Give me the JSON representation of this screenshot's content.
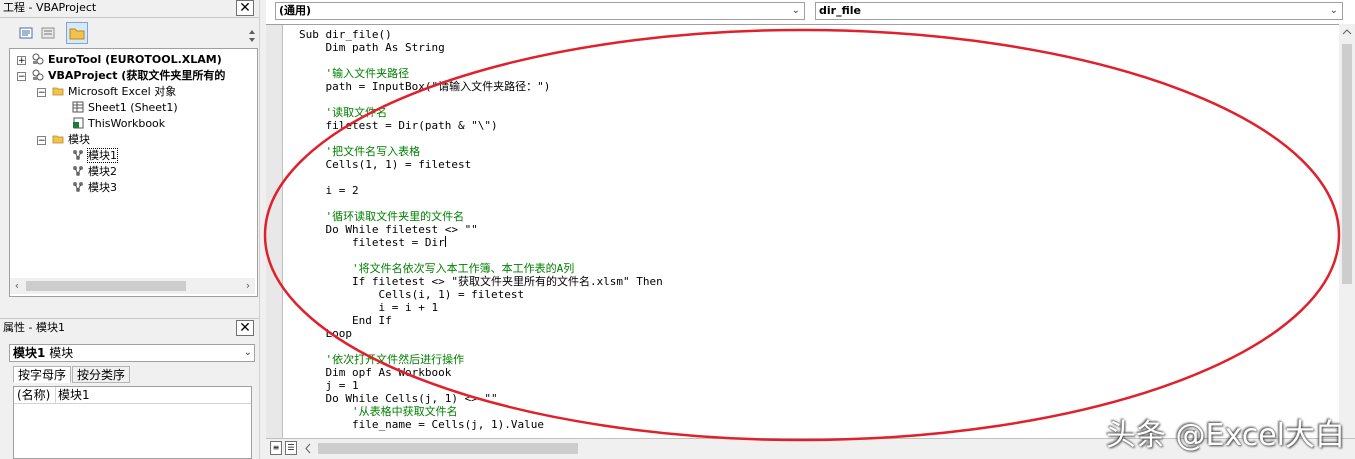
{
  "project_explorer": {
    "title": "工程 - VBAProject",
    "close_glyph": "✕",
    "toolbar_icons": [
      "view-code-icon",
      "view-object-icon",
      "toggle-folders-icon"
    ],
    "tree": [
      {
        "label": "EuroTool (EUROTOOL.XLAM)",
        "expander": "+",
        "icon": "vba-project-icon",
        "bold": true
      },
      {
        "label": "VBAProject (获取文件夹里所有的",
        "expander": "−",
        "icon": "vba-project-icon",
        "bold": true
      },
      {
        "label": "Microsoft Excel 对象",
        "expander": "−",
        "icon": "folder-icon",
        "bold": false
      },
      {
        "label": "Sheet1 (Sheet1)",
        "expander": "",
        "icon": "worksheet-icon",
        "bold": false
      },
      {
        "label": "ThisWorkbook",
        "expander": "",
        "icon": "workbook-icon",
        "bold": false
      },
      {
        "label": "模块",
        "expander": "−",
        "icon": "folder-icon",
        "bold": false
      },
      {
        "label": "模块1",
        "expander": "",
        "icon": "module-icon",
        "bold": false
      },
      {
        "label": "模块2",
        "expander": "",
        "icon": "module-icon",
        "bold": false
      },
      {
        "label": "模块3",
        "expander": "",
        "icon": "module-icon",
        "bold": false
      }
    ]
  },
  "properties": {
    "title": "属性 - 模块1",
    "close_glyph": "✕",
    "object_name": "模块1",
    "object_type": "模块",
    "tabs": [
      "按字母序",
      "按分类序"
    ],
    "active_tab": 0,
    "rows": [
      {
        "name": "(名称)",
        "value": "模块1"
      }
    ]
  },
  "code_window": {
    "object_combo": "(通用)",
    "procedure_combo": "dir_file",
    "lines": [
      {
        "text": "Sub dir_file()",
        "type": "code"
      },
      {
        "text": "    Dim path As String",
        "type": "code"
      },
      {
        "text": "",
        "type": "code"
      },
      {
        "text": "    '输入文件夹路径",
        "type": "comment"
      },
      {
        "text": "    path = InputBox(\"请输入文件夹路径：\")",
        "type": "code"
      },
      {
        "text": "",
        "type": "code"
      },
      {
        "text": "    '读取文件名",
        "type": "comment"
      },
      {
        "text": "    filetest = Dir(path & \"\\\")",
        "type": "code"
      },
      {
        "text": "",
        "type": "code"
      },
      {
        "text": "    '把文件名写入表格",
        "type": "comment"
      },
      {
        "text": "    Cells(1, 1) = filetest",
        "type": "code"
      },
      {
        "text": "",
        "type": "code"
      },
      {
        "text": "    i = 2",
        "type": "code"
      },
      {
        "text": "",
        "type": "code"
      },
      {
        "text": "    '循环读取文件夹里的文件名",
        "type": "comment"
      },
      {
        "text": "    Do While filetest <> \"\"",
        "type": "code"
      },
      {
        "text": "        filetest = Dir",
        "type": "code",
        "caret": true
      },
      {
        "text": "",
        "type": "code"
      },
      {
        "text": "        '将文件名依次写入本工作簿、本工作表的A列",
        "type": "comment"
      },
      {
        "text": "        If filetest <> \"获取文件夹里所有的文件名.xlsm\" Then",
        "type": "code"
      },
      {
        "text": "            Cells(i, 1) = filetest",
        "type": "code"
      },
      {
        "text": "            i = i + 1",
        "type": "code"
      },
      {
        "text": "        End If",
        "type": "code"
      },
      {
        "text": "    Loop",
        "type": "code"
      },
      {
        "text": "",
        "type": "code"
      },
      {
        "text": "    '依次打开文件然后进行操作",
        "type": "comment"
      },
      {
        "text": "    Dim opf As Workbook",
        "type": "code"
      },
      {
        "text": "    j = 1",
        "type": "code"
      },
      {
        "text": "    Do While Cells(j, 1) <> \"\"",
        "type": "code"
      },
      {
        "text": "        '从表格中获取文件名",
        "type": "comment"
      },
      {
        "text": "        file_name = Cells(j, 1).Value",
        "type": "code"
      }
    ]
  },
  "watermark": "头条 @Excel大白",
  "colors": {
    "comment": "#008000",
    "annotation_ellipse": "#e0202a",
    "chrome": "#f0f0f0"
  }
}
